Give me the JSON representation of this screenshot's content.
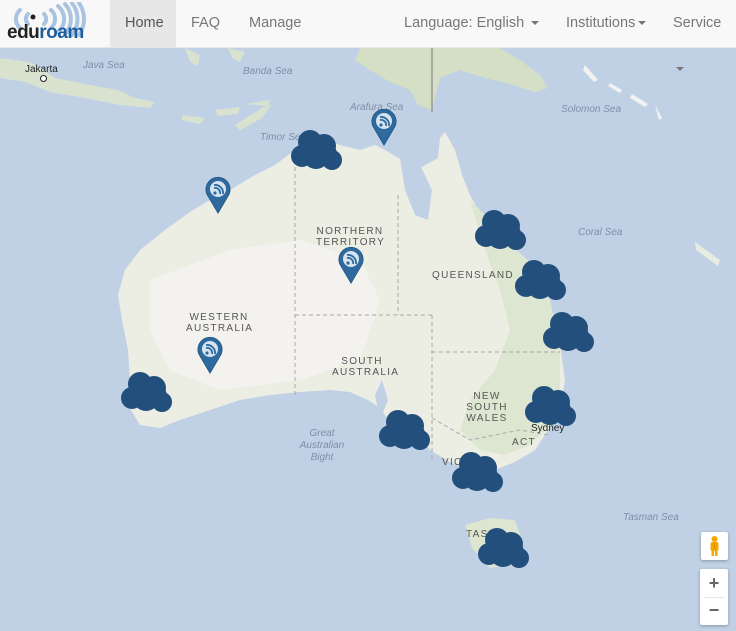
{
  "navbar": {
    "brand": "eduroam",
    "items": [
      {
        "label": "Home",
        "active": true
      },
      {
        "label": "FAQ",
        "active": false
      },
      {
        "label": "Manage",
        "active": false
      }
    ],
    "right_items": [
      {
        "label": "Language: English",
        "dropdown": true
      },
      {
        "label": "Institutions",
        "dropdown": true
      },
      {
        "label": "Service",
        "dropdown": true
      }
    ]
  },
  "map": {
    "sea_labels": [
      "Java Sea",
      "Banda Sea",
      "Timor Sea",
      "Arafura Sea",
      "Solomon Sea",
      "Coral Sea",
      "Great Australian Bight",
      "Tasman Sea"
    ],
    "region_labels": [
      "NORTHERN TERRITORY",
      "QUEENSLAND",
      "WESTERN AUSTRALIA",
      "SOUTH AUSTRALIA",
      "NEW SOUTH WALES",
      "ACT",
      "VICTORIA",
      "TASMANIA"
    ],
    "city_labels": [
      "Jakarta",
      "Sydney"
    ],
    "marker_icon": "wifi-pin-icon",
    "cluster_icon": "cluster-cloud-icon",
    "colors": {
      "water": "#c0d1e6",
      "land": "#eceee4",
      "marker": "#2e6a9e",
      "cluster": "#234f7d"
    },
    "controls": {
      "pegman": "street-view-pegman",
      "zoom_in": "+",
      "zoom_out": "−"
    }
  }
}
